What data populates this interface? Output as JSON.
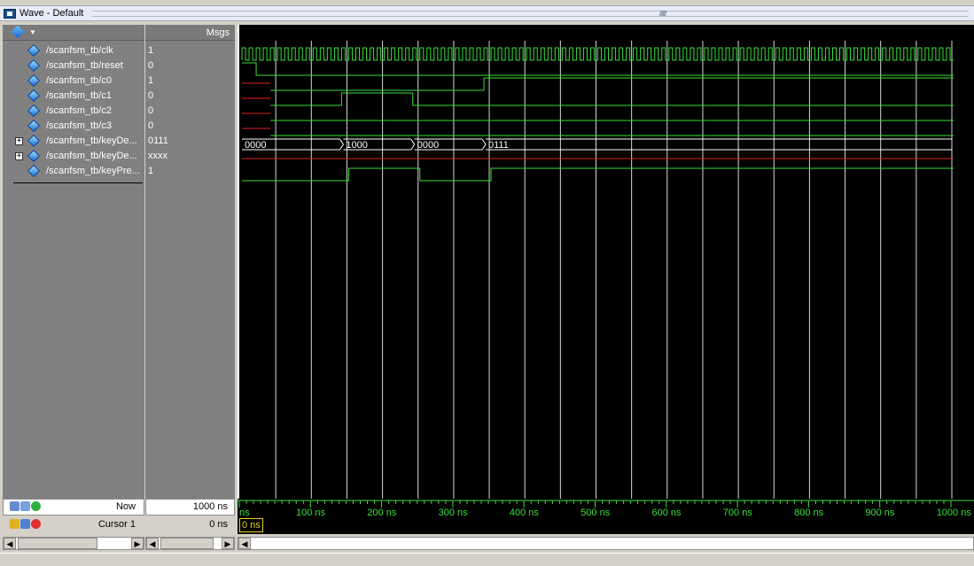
{
  "window": {
    "title": "Wave - Default"
  },
  "header": {
    "msgs_label": "Msgs"
  },
  "signals": [
    {
      "name": "/scanfsm_tb/clk",
      "value": "1",
      "expandable": false
    },
    {
      "name": "/scanfsm_tb/reset",
      "value": "0",
      "expandable": false
    },
    {
      "name": "/scanfsm_tb/c0",
      "value": "1",
      "expandable": false
    },
    {
      "name": "/scanfsm_tb/c1",
      "value": "0",
      "expandable": false
    },
    {
      "name": "/scanfsm_tb/c2",
      "value": "0",
      "expandable": false
    },
    {
      "name": "/scanfsm_tb/c3",
      "value": "0",
      "expandable": false
    },
    {
      "name": "/scanfsm_tb/keyDe...",
      "value": "0111",
      "expandable": true
    },
    {
      "name": "/scanfsm_tb/keyDe...",
      "value": "xxxx",
      "expandable": true
    },
    {
      "name": "/scanfsm_tb/keyPre...",
      "value": "1",
      "expandable": false
    }
  ],
  "bus_values": [
    "0000",
    "1000",
    "0000",
    "0111"
  ],
  "footer": {
    "now_label": "Now",
    "now_value": "1000 ns",
    "cursor_label": "Cursor 1",
    "cursor_value": "0 ns",
    "cursor_marker": "0 ns"
  },
  "time_axis": {
    "unit": "ns",
    "start_label": "ns",
    "ticks": [
      "100 ns",
      "200 ns",
      "300 ns",
      "400 ns",
      "500 ns",
      "600 ns",
      "700 ns",
      "800 ns",
      "900 ns",
      "1000 ns"
    ]
  },
  "colors": {
    "wave_green": "#36e036",
    "wave_red": "#e02020",
    "grid": "#ffffff",
    "background": "#000000",
    "cursor": "#e8d020"
  }
}
